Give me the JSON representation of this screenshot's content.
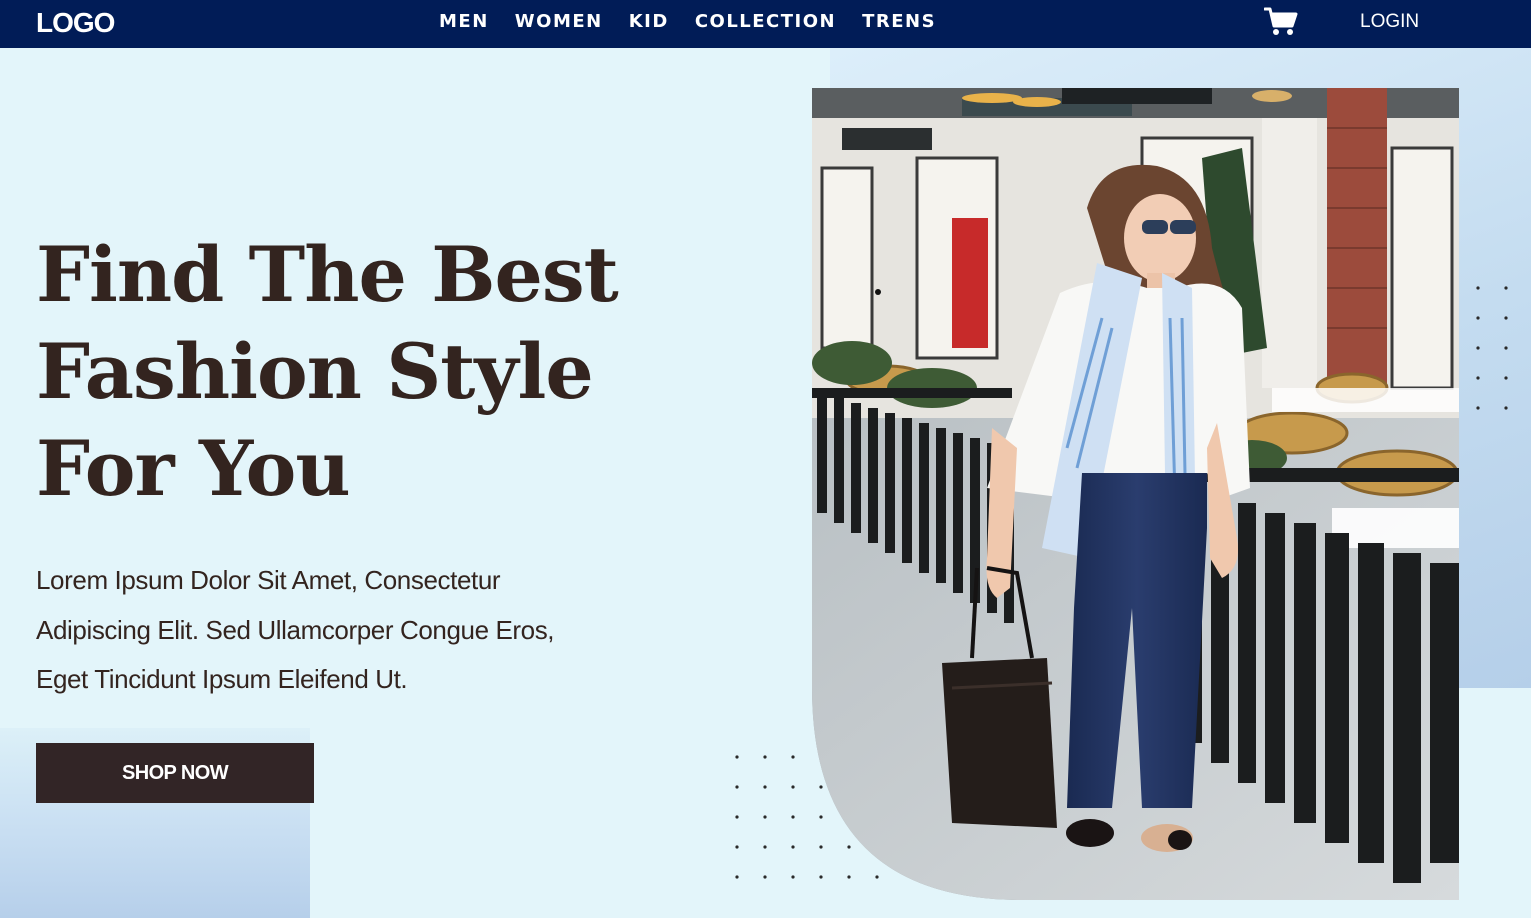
{
  "header": {
    "logo": "LOGO",
    "nav": [
      "MEN",
      "WOMEN",
      "KID",
      "COLLECTION",
      "TRENS"
    ],
    "cart_icon": "shopping-cart-icon",
    "login": "LOGIN"
  },
  "hero": {
    "headline_lines": [
      "Find The Best",
      "Fashion Style",
      "For You"
    ],
    "body_lines": [
      "Lorem Ipsum Dolor Sit Amet, Consectetur",
      "Adipiscing Elit. Sed Ullamcorper Congue Eros,",
      "Eget Tincidunt Ipsum Eleifend Ut."
    ],
    "cta": "SHOP NOW"
  },
  "colors": {
    "header_bg": "#011c57",
    "page_bg": "#e3f5fa",
    "text_dark": "#33241f",
    "button_bg": "#322526"
  }
}
